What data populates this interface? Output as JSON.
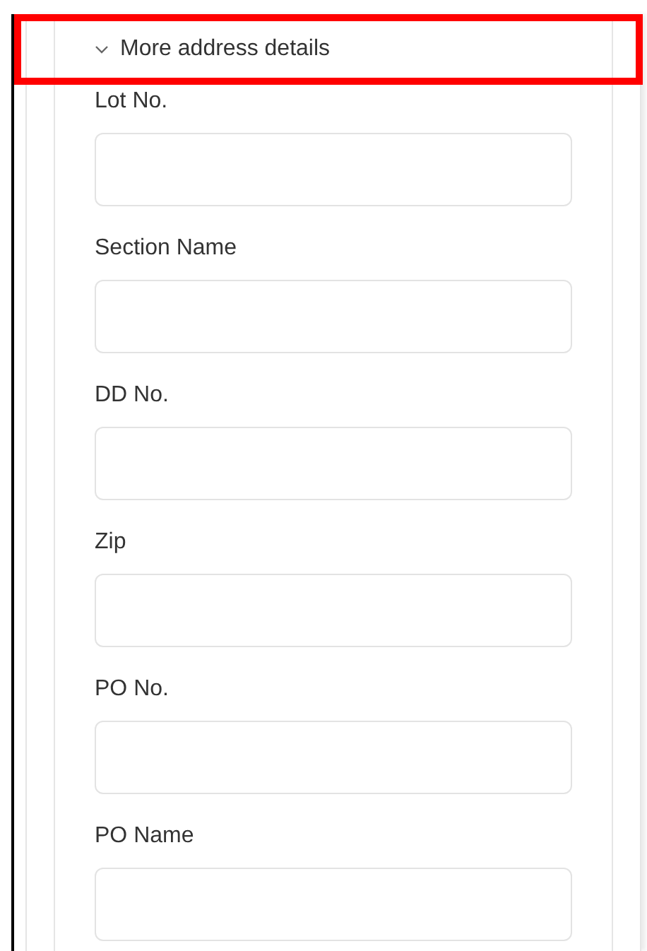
{
  "section": {
    "title": "More address details",
    "expanded": true,
    "highlighted": true
  },
  "fields": [
    {
      "label": "Lot No."
    },
    {
      "label": "Section Name"
    },
    {
      "label": "DD No."
    },
    {
      "label": "Zip"
    },
    {
      "label": "PO No."
    },
    {
      "label": "PO Name"
    }
  ]
}
